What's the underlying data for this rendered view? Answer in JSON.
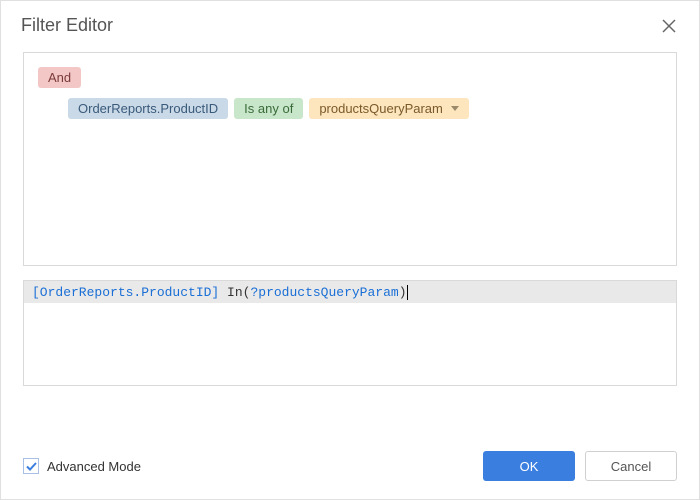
{
  "header": {
    "title": "Filter Editor"
  },
  "filter": {
    "groupOperator": "And",
    "condition": {
      "field": "OrderReports.ProductID",
      "operator": "Is any of",
      "value": "productsQueryParam"
    }
  },
  "expression": {
    "field": "[OrderReports.ProductID]",
    "func": "In",
    "open": "(",
    "param": "?productsQueryParam",
    "close": ")"
  },
  "footer": {
    "advancedModeLabel": "Advanced Mode",
    "advancedModeChecked": true,
    "okLabel": "OK",
    "cancelLabel": "Cancel"
  }
}
